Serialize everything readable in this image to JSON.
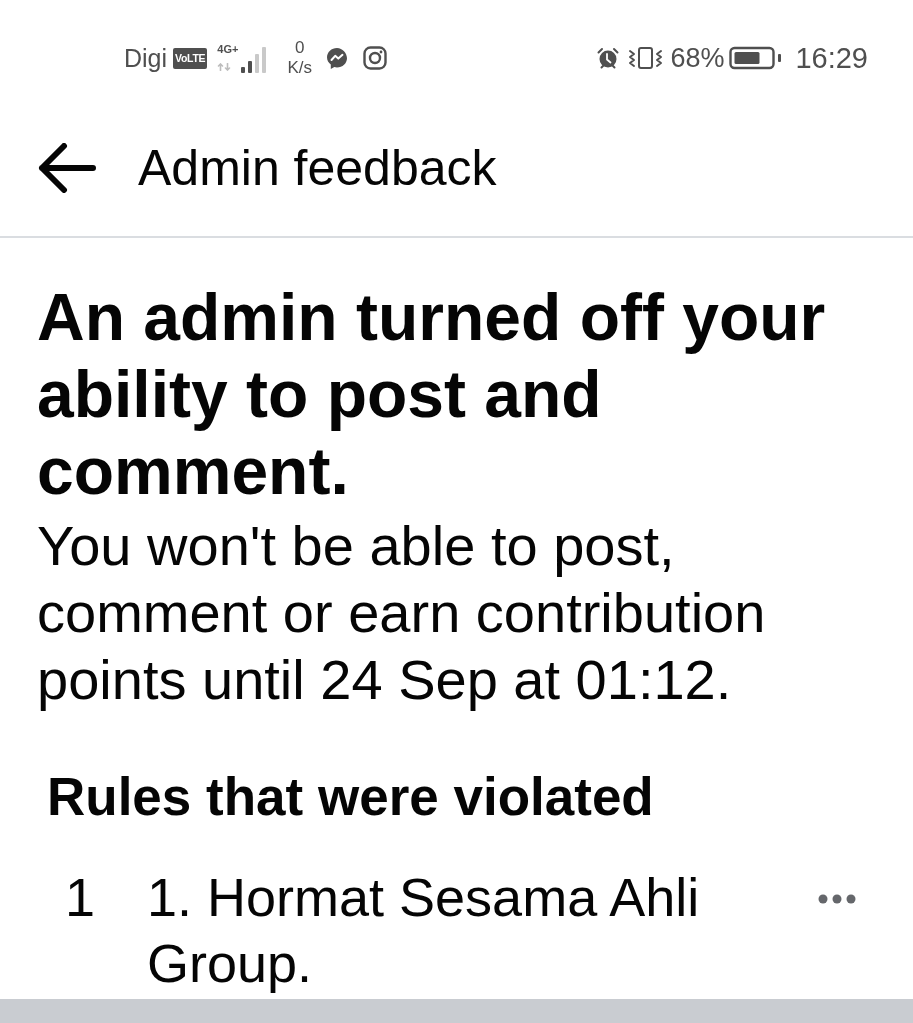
{
  "status_bar": {
    "carrier": "Digi",
    "volte_badge": "VoLTE",
    "network_type": "4G+",
    "speed_value": "0",
    "speed_unit": "K/s",
    "battery_percent": "68%",
    "time": "16:29"
  },
  "header": {
    "title": "Admin feedback"
  },
  "notice": {
    "title": "An admin turned off your ability to post and comment.",
    "body": "You won't be able to post, comment or earn contribution points until 24 Sep at 01:12."
  },
  "rules": {
    "heading": "Rules that were violated",
    "items": [
      {
        "number": "1",
        "text": "1. Hormat Sesama Ahli Group."
      }
    ]
  }
}
